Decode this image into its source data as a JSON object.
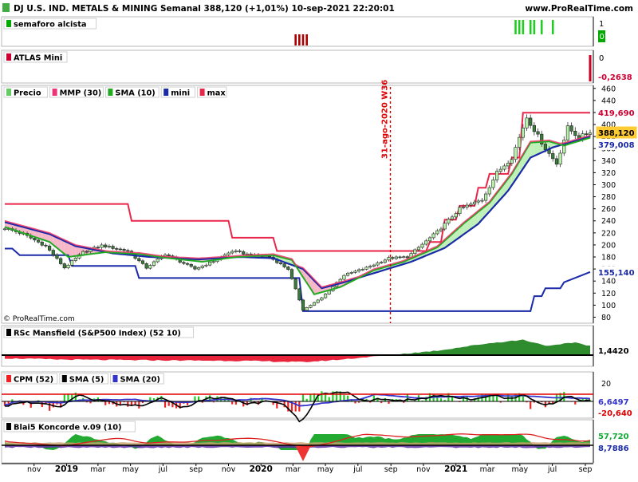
{
  "header": {
    "title": "DJ U.S. IND. METALS & MINING Semanal 388,120 (+1,01%) 10-sep-2021 22:20:01",
    "site": "www.ProRealTime.com"
  },
  "chart_data": {
    "type": "line",
    "x_range": [
      "2018-09-07",
      "2021-09-10"
    ],
    "x_tick_labels": [
      {
        "t": "2018-11-01",
        "label": "nov",
        "bold": false
      },
      {
        "t": "2019-01-01",
        "label": "2019",
        "bold": true
      },
      {
        "t": "2019-03-01",
        "label": "mar",
        "bold": false
      },
      {
        "t": "2019-05-01",
        "label": "may",
        "bold": false
      },
      {
        "t": "2019-07-01",
        "label": "jul",
        "bold": false
      },
      {
        "t": "2019-09-01",
        "label": "sep",
        "bold": false
      },
      {
        "t": "2019-11-01",
        "label": "nov",
        "bold": false
      },
      {
        "t": "2020-01-01",
        "label": "2020",
        "bold": true
      },
      {
        "t": "2020-03-01",
        "label": "mar",
        "bold": false
      },
      {
        "t": "2020-05-01",
        "label": "may",
        "bold": false
      },
      {
        "t": "2020-07-01",
        "label": "jul",
        "bold": false
      },
      {
        "t": "2020-09-01",
        "label": "sep",
        "bold": false
      },
      {
        "t": "2020-11-01",
        "label": "nov",
        "bold": false
      },
      {
        "t": "2021-01-01",
        "label": "2021",
        "bold": true
      },
      {
        "t": "2021-03-01",
        "label": "mar",
        "bold": false
      },
      {
        "t": "2021-05-01",
        "label": "may",
        "bold": false
      },
      {
        "t": "2021-07-01",
        "label": "jul",
        "bold": false
      },
      {
        "t": "2021-09-01",
        "label": "sep",
        "bold": false
      }
    ],
    "panels": [
      {
        "id": "semaforo",
        "title": "semaforo alcista",
        "title_color": "#00aa00",
        "y_ticks": [
          "1",
          "0"
        ],
        "values_box": [
          {
            "text": "0",
            "color": "#00aa00",
            "text_color": "#ffffff"
          }
        ],
        "signals": [
          {
            "t": "2020-03-06",
            "color": "#aa0000"
          },
          {
            "t": "2020-03-13",
            "color": "#aa0000"
          },
          {
            "t": "2020-03-20",
            "color": "#aa0000"
          },
          {
            "t": "2020-03-27",
            "color": "#aa0000"
          },
          {
            "t": "2021-04-23",
            "color": "#22cc22"
          },
          {
            "t": "2021-04-30",
            "color": "#22cc22"
          },
          {
            "t": "2021-05-07",
            "color": "#22cc22"
          },
          {
            "t": "2021-05-21",
            "color": "#22cc22"
          },
          {
            "t": "2021-05-28",
            "color": "#22cc22"
          },
          {
            "t": "2021-06-11",
            "color": "#22cc22"
          },
          {
            "t": "2021-07-02",
            "color": "#22cc22"
          }
        ]
      },
      {
        "id": "atlas",
        "title": "ATLAS Mini",
        "title_color": "#cc0033",
        "y_ticks": [
          "0"
        ],
        "values_box": [
          {
            "text": "-0,2638",
            "color": "#ffffff",
            "text_color": "#cc0033"
          }
        ]
      },
      {
        "id": "price",
        "legend": [
          {
            "label": "Precio",
            "color": "#66cc66"
          },
          {
            "label": "MMP (30)",
            "color": "#ee3377"
          },
          {
            "label": "SMA (10)",
            "color": "#22aa22"
          },
          {
            "label": "mini",
            "color": "#1a2aa8"
          },
          {
            "label": "max",
            "color": "#e8264a"
          }
        ],
        "y_ticks": [
          80,
          100,
          120,
          140,
          160,
          180,
          200,
          220,
          240,
          260,
          280,
          300,
          320,
          340,
          360,
          380,
          400,
          420,
          440,
          460
        ],
        "ylim": [
          70,
          465
        ],
        "annotation": {
          "t": "2020-08-31",
          "label": "31-ago-2020 W36",
          "color": "#dd0000"
        },
        "copyright": "© ProRealTime.com",
        "values_box": [
          {
            "text": "419,690",
            "color": "#ffffff",
            "text_color": "#cc0033"
          },
          {
            "text": "388,120",
            "color": "#ffcc33",
            "text_color": "#000000"
          },
          {
            "text": "379,008",
            "color": "#ffffff",
            "text_color": "#1a2aa8"
          },
          {
            "text": "155,140",
            "color": "#ffffff",
            "text_color": "#1a2aa8"
          }
        ],
        "close_anchors": [
          [
            "2018-09-07",
            228
          ],
          [
            "2018-10-12",
            218
          ],
          [
            "2018-11-23",
            198
          ],
          [
            "2018-12-28",
            162
          ],
          [
            "2019-02-01",
            188
          ],
          [
            "2019-03-08",
            199
          ],
          [
            "2019-04-26",
            190
          ],
          [
            "2019-05-31",
            162
          ],
          [
            "2019-07-05",
            185
          ],
          [
            "2019-08-30",
            160
          ],
          [
            "2019-10-04",
            173
          ],
          [
            "2019-11-08",
            190
          ],
          [
            "2019-12-13",
            183
          ],
          [
            "2020-01-17",
            180
          ],
          [
            "2020-02-21",
            160
          ],
          [
            "2020-03-20",
            92
          ],
          [
            "2020-04-24",
            112
          ],
          [
            "2020-06-05",
            150
          ],
          [
            "2020-07-17",
            162
          ],
          [
            "2020-08-28",
            178
          ],
          [
            "2020-10-02",
            180
          ],
          [
            "2020-11-27",
            222
          ],
          [
            "2021-01-08",
            260
          ],
          [
            "2021-02-19",
            275
          ],
          [
            "2021-03-19",
            320
          ],
          [
            "2021-04-16",
            345
          ],
          [
            "2021-05-14",
            412
          ],
          [
            "2021-06-18",
            360
          ],
          [
            "2021-07-09",
            335
          ],
          [
            "2021-07-30",
            395
          ],
          [
            "2021-08-20",
            378
          ],
          [
            "2021-09-10",
            388.12
          ]
        ],
        "sma10_anchors": [
          [
            "2018-09-07",
            230
          ],
          [
            "2018-11-30",
            205
          ],
          [
            "2019-01-04",
            180
          ],
          [
            "2019-03-15",
            188
          ],
          [
            "2019-05-17",
            185
          ],
          [
            "2019-07-12",
            178
          ],
          [
            "2019-09-13",
            172
          ],
          [
            "2019-11-15",
            180
          ],
          [
            "2020-01-24",
            183
          ],
          [
            "2020-02-28",
            175
          ],
          [
            "2020-04-10",
            118
          ],
          [
            "2020-05-29",
            130
          ],
          [
            "2020-07-31",
            158
          ],
          [
            "2020-09-25",
            172
          ],
          [
            "2020-11-27",
            196
          ],
          [
            "2021-01-15",
            235
          ],
          [
            "2021-03-05",
            270
          ],
          [
            "2021-04-16",
            318
          ],
          [
            "2021-05-21",
            370
          ],
          [
            "2021-06-25",
            372
          ],
          [
            "2021-07-23",
            365
          ],
          [
            "2021-09-10",
            378
          ]
        ],
        "mmp30_anchors": [
          [
            "2018-09-07",
            238
          ],
          [
            "2018-11-30",
            218
          ],
          [
            "2019-01-18",
            198
          ],
          [
            "2019-03-29",
            186
          ],
          [
            "2019-06-07",
            180
          ],
          [
            "2019-09-06",
            176
          ],
          [
            "2019-11-22",
            180
          ],
          [
            "2020-01-24",
            178
          ],
          [
            "2020-03-20",
            160
          ],
          [
            "2020-04-24",
            128
          ],
          [
            "2020-06-05",
            138
          ],
          [
            "2020-08-07",
            155
          ],
          [
            "2020-10-09",
            172
          ],
          [
            "2020-12-11",
            195
          ],
          [
            "2021-02-12",
            235
          ],
          [
            "2021-04-09",
            290
          ],
          [
            "2021-05-21",
            345
          ],
          [
            "2021-07-02",
            362
          ],
          [
            "2021-09-10",
            380
          ]
        ],
        "mini_steps": [
          [
            "2018-09-07",
            194
          ],
          [
            "2018-09-21",
            194
          ],
          [
            "2018-10-05",
            183
          ],
          [
            "2019-01-04",
            183
          ],
          [
            "2019-01-11",
            165
          ],
          [
            "2019-05-10",
            165
          ],
          [
            "2019-05-17",
            145
          ],
          [
            "2020-03-13",
            145
          ],
          [
            "2020-03-20",
            90
          ],
          [
            "2021-05-21",
            90
          ],
          [
            "2021-05-28",
            115
          ],
          [
            "2021-06-11",
            115
          ],
          [
            "2021-06-18",
            128
          ],
          [
            "2021-07-16",
            128
          ],
          [
            "2021-07-23",
            138
          ],
          [
            "2021-08-27",
            150
          ],
          [
            "2021-09-10",
            155.14
          ]
        ],
        "max_steps": [
          [
            "2018-09-07",
            268
          ],
          [
            "2019-04-26",
            268
          ],
          [
            "2019-05-03",
            240
          ],
          [
            "2019-11-01",
            240
          ],
          [
            "2019-11-08",
            212
          ],
          [
            "2020-01-24",
            212
          ],
          [
            "2020-01-31",
            190
          ],
          [
            "2020-11-06",
            190
          ],
          [
            "2020-11-13",
            205
          ],
          [
            "2020-12-04",
            205
          ],
          [
            "2020-12-11",
            242
          ],
          [
            "2021-01-01",
            242
          ],
          [
            "2021-01-08",
            265
          ],
          [
            "2021-02-05",
            265
          ],
          [
            "2021-02-12",
            295
          ],
          [
            "2021-02-26",
            295
          ],
          [
            "2021-03-05",
            318
          ],
          [
            "2021-04-09",
            318
          ],
          [
            "2021-04-16",
            345
          ],
          [
            "2021-04-30",
            345
          ],
          [
            "2021-05-07",
            419.69
          ],
          [
            "2021-09-10",
            419.69
          ]
        ]
      },
      {
        "id": "rsc",
        "title": "RSc Mansfield (S&P500 Index) (52 10)",
        "values_box": [
          {
            "text": "1,4420",
            "color": "#ffffff",
            "text_color": "#000000"
          }
        ],
        "anchors": [
          [
            "2018-09-07",
            -0.5
          ],
          [
            "2018-12-28",
            -0.7
          ],
          [
            "2019-05-31",
            -0.8
          ],
          [
            "2019-11-29",
            -0.9
          ],
          [
            "2020-03-20",
            -1.1
          ],
          [
            "2020-05-29",
            -0.7
          ],
          [
            "2020-08-28",
            0.0
          ],
          [
            "2020-11-27",
            0.7
          ],
          [
            "2021-02-26",
            1.8
          ],
          [
            "2021-05-07",
            2.4
          ],
          [
            "2021-06-25",
            1.4
          ],
          [
            "2021-08-13",
            2.0
          ],
          [
            "2021-09-10",
            1.442
          ]
        ]
      },
      {
        "id": "cpm",
        "legend": [
          {
            "label": "CPM (52)",
            "color": "#ee2222"
          },
          {
            "label": "SMA (5)",
            "color": "#000000"
          },
          {
            "label": "SMA (20)",
            "color": "#3333cc"
          }
        ],
        "y_ticks": [
          "20",
          "0"
        ],
        "values_box": [
          {
            "text": "6,6497",
            "color": "#ffffff",
            "text_color": "#3333cc"
          },
          {
            "text": "-20,640",
            "color": "#ffffff",
            "text_color": "#dd0000"
          }
        ]
      },
      {
        "id": "blai5",
        "title": "Blai5 Koncorde v.09 (10)",
        "values_box": [
          {
            "text": "57,720",
            "color": "#ffffff",
            "text_color": "#11aa33"
          },
          {
            "text": "8,7886",
            "color": "#ffffff",
            "text_color": "#1a2aa8"
          }
        ]
      }
    ]
  }
}
